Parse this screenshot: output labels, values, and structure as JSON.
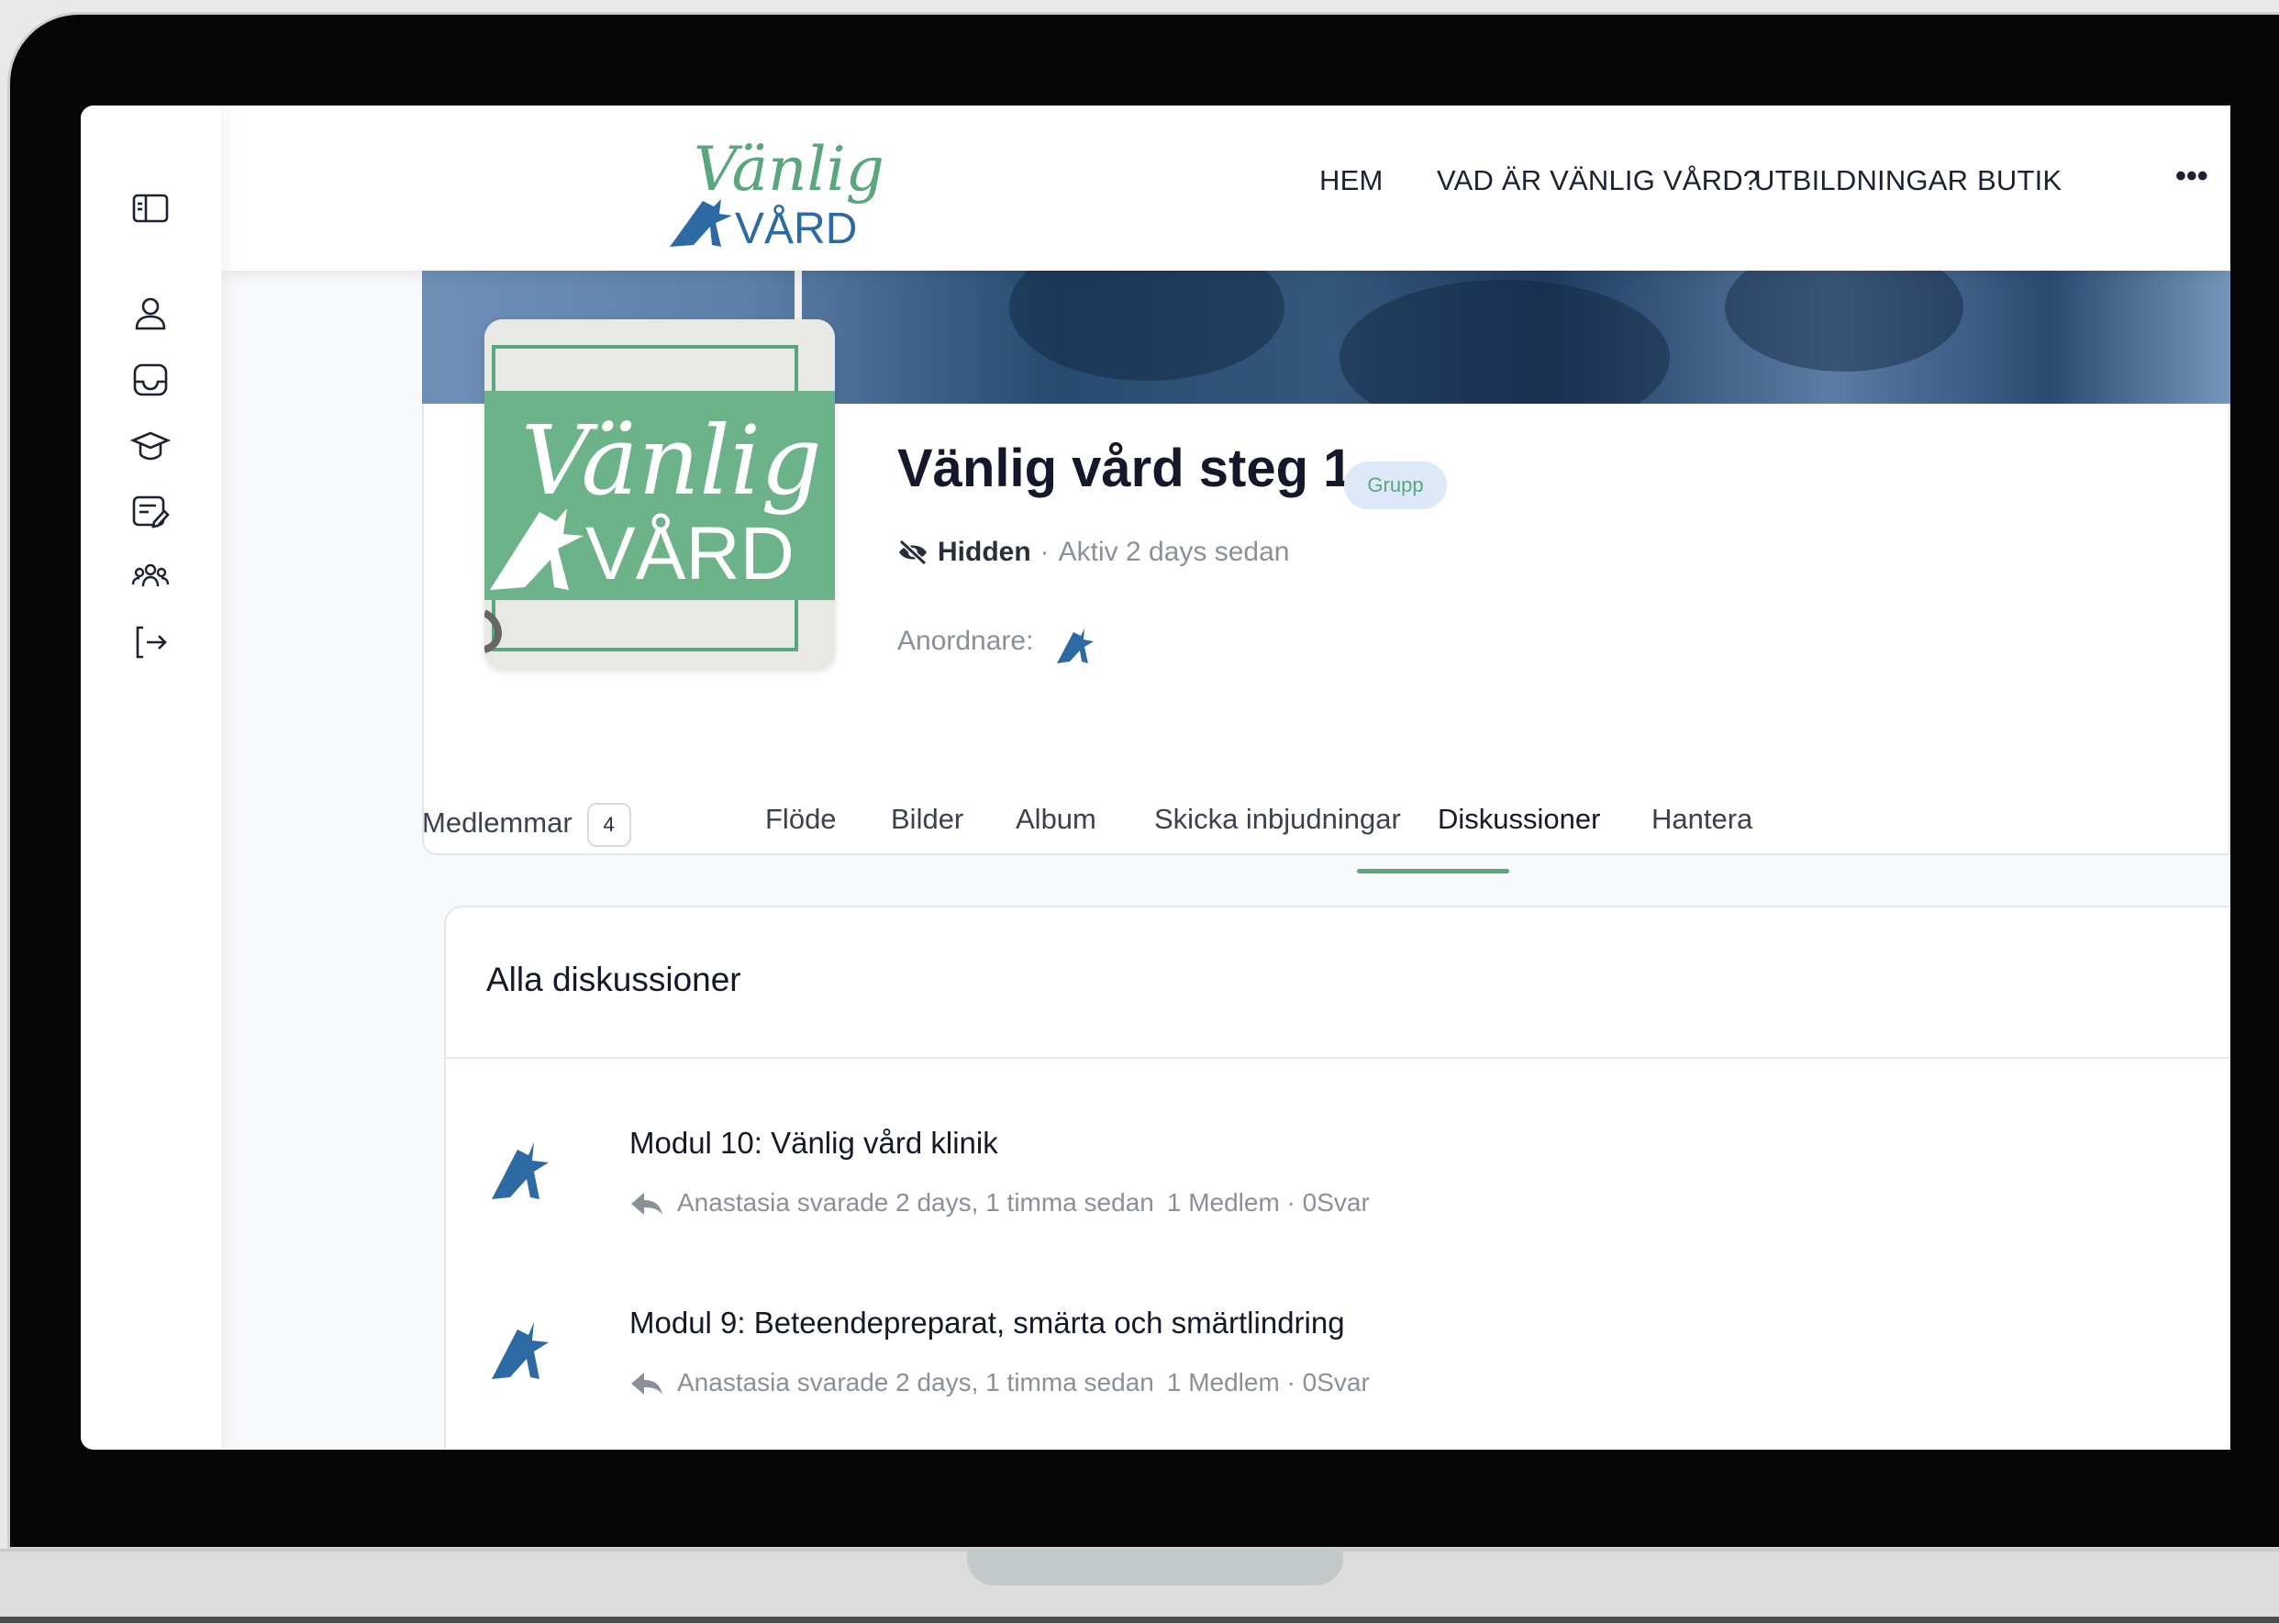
{
  "brand": {
    "logo_line1": "Vänlig",
    "logo_line2": "VÅRD",
    "green": "#5aa67d",
    "blue": "#2d6aa3"
  },
  "nav": {
    "items": [
      "HEM",
      "VAD ÄR VÄNLIG VÅRD?",
      "UTBILDNINGAR",
      "BUTIK"
    ],
    "more": "•••"
  },
  "sidebar": {
    "icons": [
      "panel-toggle-icon",
      "profile-icon",
      "inbox-icon",
      "courses-icon",
      "notes-icon",
      "groups-icon",
      "logout-icon"
    ]
  },
  "group": {
    "title": "Vänlig vård steg 1",
    "badge": "Grupp",
    "visibility": "Hidden",
    "separator": "·",
    "activity": "Aktiv 2 days sedan",
    "organizer_label": "Anordnare:"
  },
  "tabs": {
    "members_label": "Medlemmar",
    "members_count": "4",
    "items": [
      "Flöde",
      "Bilder",
      "Album",
      "Skicka inbjudningar",
      "Diskussioner",
      "Hantera"
    ],
    "active": "Diskussioner"
  },
  "discussions": {
    "header": "Alla diskussioner",
    "items": [
      {
        "title": "Modul 10: Vänlig vård klinik",
        "reply": "Anastasia svarade 2 days, 1 timma sedan",
        "stats": "1 Medlem · 0Svar"
      },
      {
        "title": "Modul 9: Beteendepreparat, smärta och smärtlindring",
        "reply": "Anastasia svarade 2 days, 1 timma sedan",
        "stats": "1 Medlem · 0Svar"
      }
    ]
  }
}
